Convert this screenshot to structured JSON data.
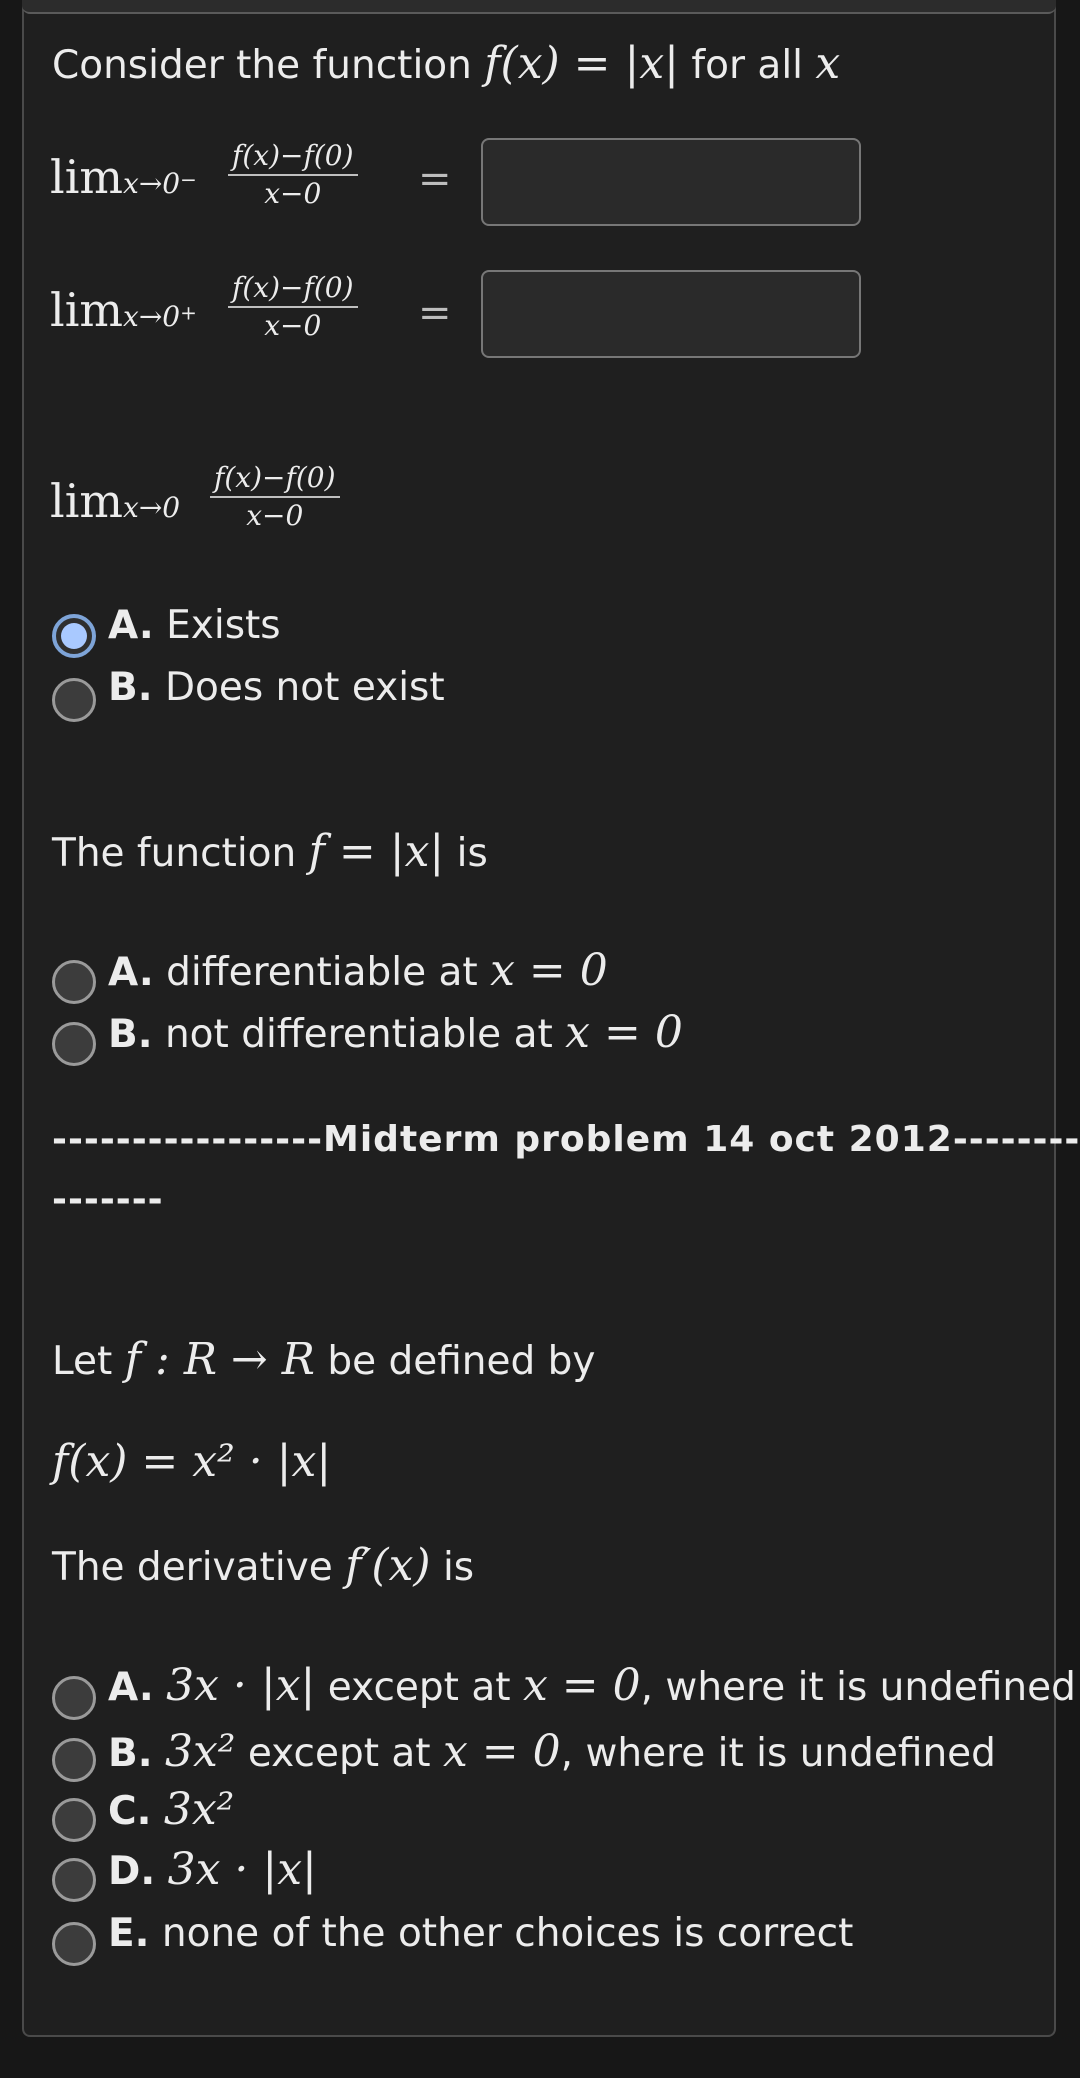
{
  "q1": {
    "intro_text": "Consider the function",
    "intro_math": "f(x) = |x|",
    "intro_suffix": "for all",
    "intro_var": "x",
    "limits": [
      {
        "lim": "lim",
        "sub": "x→0",
        "sup": "−",
        "num": "f(x)−f(0)",
        "den": "x−0",
        "eq": "=",
        "input_value": ""
      },
      {
        "lim": "lim",
        "sub": "x→0",
        "sup": "+",
        "num": "f(x)−f(0)",
        "den": "x−0",
        "eq": "=",
        "input_value": ""
      }
    ],
    "limit3": {
      "lim": "lim",
      "sub": "x→0",
      "num": "f(x)−f(0)",
      "den": "x−0"
    },
    "options": [
      {
        "letter": "A.",
        "text": "Exists",
        "selected": true
      },
      {
        "letter": "B.",
        "text": "Does not exist",
        "selected": false
      }
    ]
  },
  "q2": {
    "prefix": "The function",
    "math": "f = |x|",
    "suffix": "is",
    "options": [
      {
        "letter": "A.",
        "text": "differentiable at",
        "math": "x = 0",
        "selected": false
      },
      {
        "letter": "B.",
        "text": "not differentiable at",
        "math": "x = 0",
        "selected": false
      }
    ]
  },
  "divider": {
    "line1": "-----------------Midterm problem 14 oct 2012--------",
    "line2": "-------"
  },
  "q3": {
    "let_text": "Let",
    "let_math": "f : R → R",
    "let_suffix": "be defined by",
    "definition": "f(x) = x² · |x|",
    "deriv_prefix": "The derivative",
    "deriv_math": "f′(x)",
    "deriv_suffix": "is",
    "options": [
      {
        "letter": "A.",
        "math": "3x · |x|",
        "text": "except at",
        "math2": "x = 0",
        "text2": ", where it is undefined",
        "selected": false
      },
      {
        "letter": "B.",
        "math": "3x²",
        "text": "except at",
        "math2": "x = 0",
        "text2": ", where it is undefined",
        "selected": false
      },
      {
        "letter": "C.",
        "math": "3x²",
        "selected": false
      },
      {
        "letter": "D.",
        "math": "3x · |x|",
        "selected": false
      },
      {
        "letter": "E.",
        "text": "none of the other choices is correct",
        "selected": false
      }
    ]
  }
}
